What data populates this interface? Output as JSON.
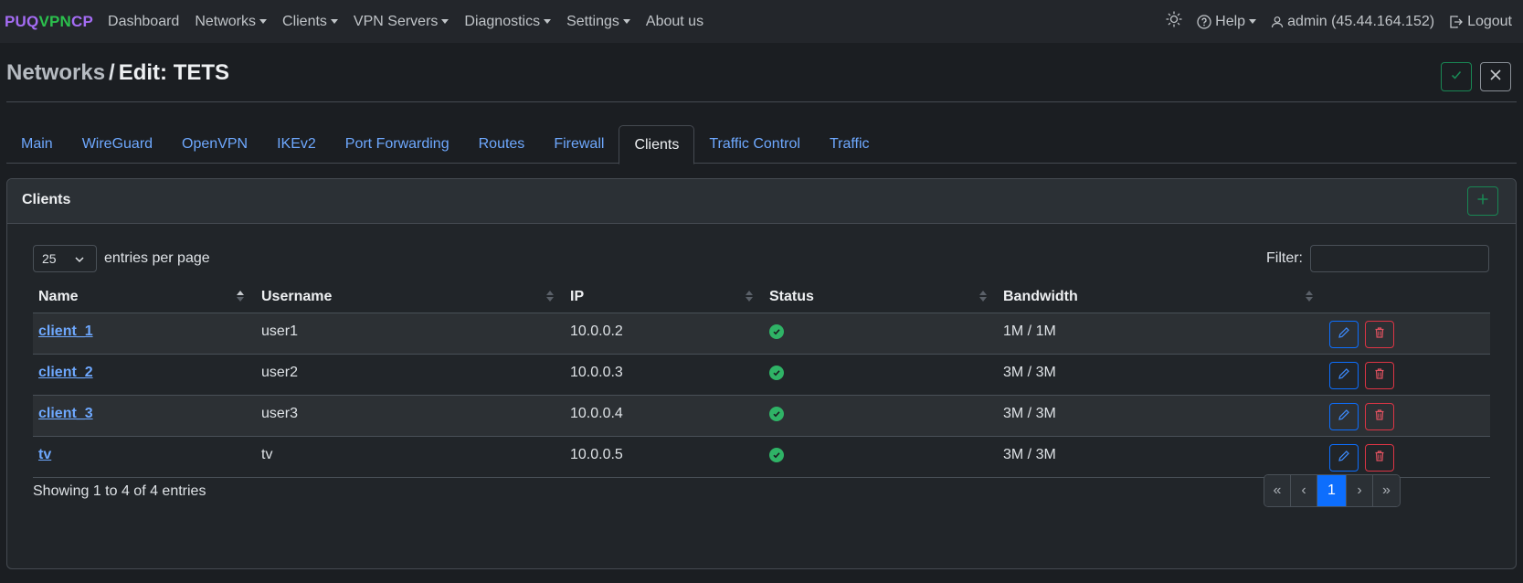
{
  "brand": {
    "part1": "PUQ",
    "part2": "VPN",
    "part3": "CP"
  },
  "nav": {
    "items": [
      {
        "label": "Dashboard",
        "dropdown": false
      },
      {
        "label": "Networks",
        "dropdown": true
      },
      {
        "label": "Clients",
        "dropdown": true
      },
      {
        "label": "VPN Servers",
        "dropdown": true
      },
      {
        "label": "Diagnostics",
        "dropdown": true
      },
      {
        "label": "Settings",
        "dropdown": true
      },
      {
        "label": "About us",
        "dropdown": false
      }
    ],
    "help": "Help",
    "user": "admin (45.44.164.152)",
    "logout": "Logout"
  },
  "header": {
    "crumb": "Networks",
    "separator": "/",
    "current": "Edit: TETS"
  },
  "tabs": [
    "Main",
    "WireGuard",
    "OpenVPN",
    "IKEv2",
    "Port Forwarding",
    "Routes",
    "Firewall",
    "Clients",
    "Traffic Control",
    "Traffic"
  ],
  "active_tab": "Clients",
  "card": {
    "title": "Clients"
  },
  "table_controls": {
    "per_page_value": "25",
    "per_page_label": "entries per page",
    "filter_label": "Filter:",
    "filter_value": ""
  },
  "table": {
    "columns": [
      "Name",
      "Username",
      "IP",
      "Status",
      "Bandwidth"
    ],
    "rows": [
      {
        "name": "client_1",
        "username": "user1",
        "ip": "10.0.0.2",
        "status": "online",
        "bandwidth": "1M / 1M"
      },
      {
        "name": "client_2",
        "username": "user2",
        "ip": "10.0.0.3",
        "status": "online",
        "bandwidth": "3M / 3M"
      },
      {
        "name": "client_3",
        "username": "user3",
        "ip": "10.0.0.4",
        "status": "online",
        "bandwidth": "3M / 3M"
      },
      {
        "name": "tv",
        "username": "tv",
        "ip": "10.0.0.5",
        "status": "online",
        "bandwidth": "3M / 3M"
      }
    ]
  },
  "footer": {
    "info": "Showing 1 to 4 of 4 entries"
  },
  "pagination": {
    "first": "«",
    "prev": "‹",
    "current": "1",
    "next": "›",
    "last": "»"
  },
  "colors": {
    "brand_purple": "#a46cf3",
    "brand_green": "#2bc04d",
    "link": "#6ea8fe",
    "success": "#198754",
    "danger": "#dc3545",
    "primary": "#0d6efd"
  }
}
